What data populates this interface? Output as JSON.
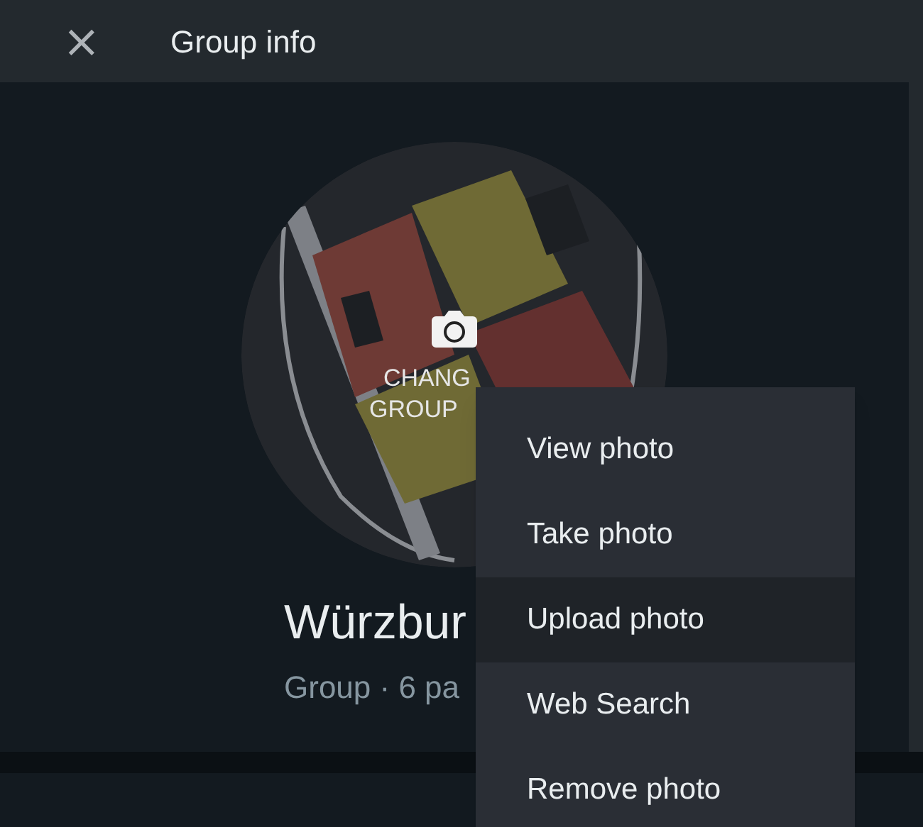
{
  "header": {
    "close": "×",
    "title": "Group info"
  },
  "photo": {
    "kind": "picture",
    "overlay_lines": [
      "CHANG",
      "GROUP"
    ]
  },
  "group": {
    "name": "Würzbur",
    "subtitle": "Group · 6 pa"
  },
  "menu": [
    {
      "label": "View photo",
      "selected": false
    },
    {
      "label": "Take photo",
      "selected": false
    },
    {
      "label": "Upload photo",
      "selected": true
    },
    {
      "label": "Web Search",
      "selected": false
    },
    {
      "label": "Remove photo",
      "selected": false
    }
  ]
}
